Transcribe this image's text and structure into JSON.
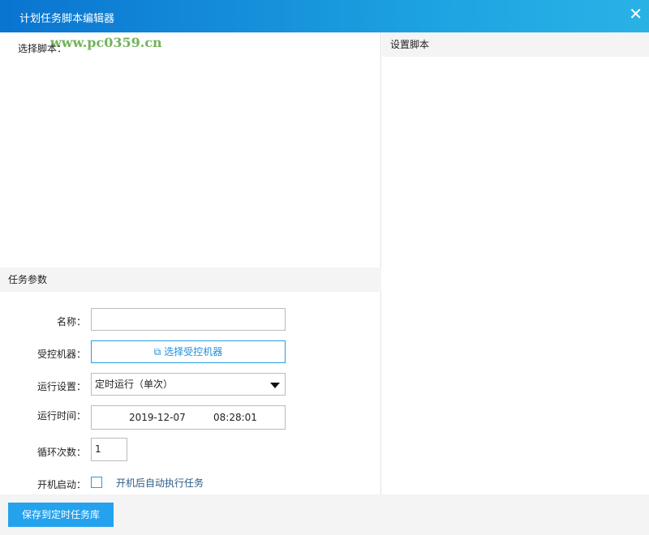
{
  "window": {
    "title": "计划任务脚本编辑器",
    "close_icon": "close-icon"
  },
  "watermark": "www.pc0359.cn",
  "left": {
    "select_script_label": "选择脚本："
  },
  "right": {
    "header": "设置脚本"
  },
  "params": {
    "header": "任务参数",
    "name": {
      "label": "名称：",
      "value": ""
    },
    "machine": {
      "label": "受控机器：",
      "button": "选择受控机器",
      "icon": "external-link-icon"
    },
    "run_setting": {
      "label": "运行设置：",
      "value": "定时运行（单次）"
    },
    "run_time": {
      "label": "运行时间：",
      "date": "2019-12-07",
      "time": "08:28:01"
    },
    "loop_count": {
      "label": "循环次数：",
      "value": "1"
    },
    "autostart": {
      "label": "开机启动：",
      "text": "开机后自动执行任务",
      "checked": false
    }
  },
  "footer": {
    "save_button": "保存到定时任务库"
  }
}
